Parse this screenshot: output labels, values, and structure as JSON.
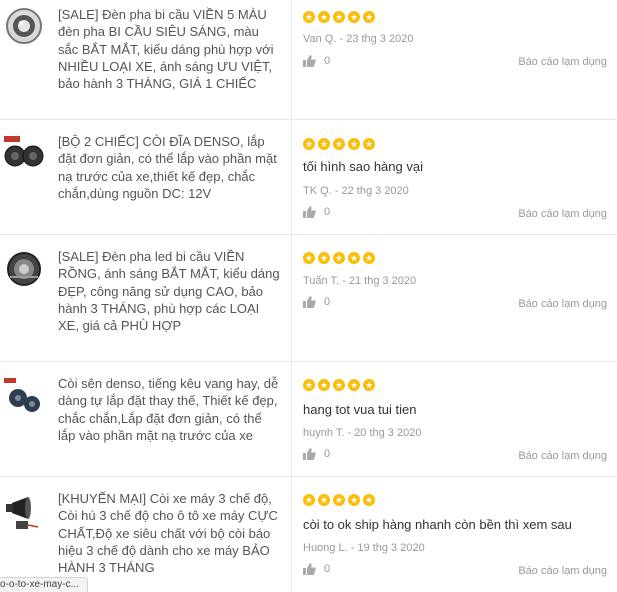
{
  "reviews": [
    {
      "product": "[SALE] Đèn pha bi cầu VIỀN 5 MÀU đèn pha BI CẦU SIÊU SÁNG, màu sắc BẮT MẮT, kiểu dáng phù hợp với NHIỀU LOẠI XE, ánh sáng ƯU VIỆT, bảo hành 3 THÁNG, GIÁ 1 CHIẾC",
      "image": "headlight-image",
      "rating": 5,
      "comment": "",
      "author_date": "Van Q. - 23 thg 3 2020",
      "likes": "0",
      "report": "Báo cáo lạm dụng"
    },
    {
      "product": "[BỘ 2 CHIẾC] CÒI ĐĨA DENSO, lắp đặt đơn giản, có thể lắp vào phần mặt nạ trước của xe,thiết kế đẹp, chắc chắn,dùng nguồn DC: 12V",
      "image": "horn-pair-image",
      "rating": 5,
      "comment": "tối hình sao hàng vại",
      "author_date": "TK Q. - 22 thg 3 2020",
      "likes": "0",
      "report": "Báo cáo lạm dụng"
    },
    {
      "product": "[SALE] Đèn pha led bi cầu VIỀN RỒNG, ánh sáng BẮT MẮT, kiểu dáng ĐẸP, công năng sử dụng CAO, bảo hành 3 THÁNG, phù hợp các LOẠI XE, giá cả PHÙ HỢP",
      "image": "led-headlight-image",
      "rating": 5,
      "comment": "",
      "author_date": "Tuấn T. - 21 thg 3 2020",
      "likes": "0",
      "report": "Báo cáo lạm dụng"
    },
    {
      "product": "Còi sên denso, tiếng kêu vang hay, dễ dàng tự lắp đặt thay thế, Thiết kế đẹp, chắc chắn,Lắp đặt đơn giản, có thể lắp vào phần mặt nạ trước của xe",
      "image": "snail-horn-image",
      "rating": 5,
      "comment": "hang tot vua tui tien",
      "author_date": "huynh T. - 20 thg 3 2020",
      "likes": "0",
      "report": "Báo cáo lạm dụng"
    },
    {
      "product": "[KHUYẾN MẠI] Còi xe máy 3 chế độ, Còi hú 3 chế độ cho ô tô xe máy CỰC CHẤT,Độ xe siêu chất với bộ còi báo hiệu 3 chế độ dành cho xe máy BẢO HÀNH 3 THÁNG",
      "image": "siren-horn-image",
      "rating": 5,
      "comment": "còi to ok ship hàng nhanh còn bền thì xem sau",
      "author_date": "Huong L. - 19 thg 3 2020",
      "likes": "0",
      "report": "Báo cáo lạm dụng"
    }
  ],
  "status_url": "o-o-to-xe-may-c...",
  "colors": {
    "star": "#fbbd08",
    "divider": "#e8e8e8",
    "muted": "#999999"
  }
}
